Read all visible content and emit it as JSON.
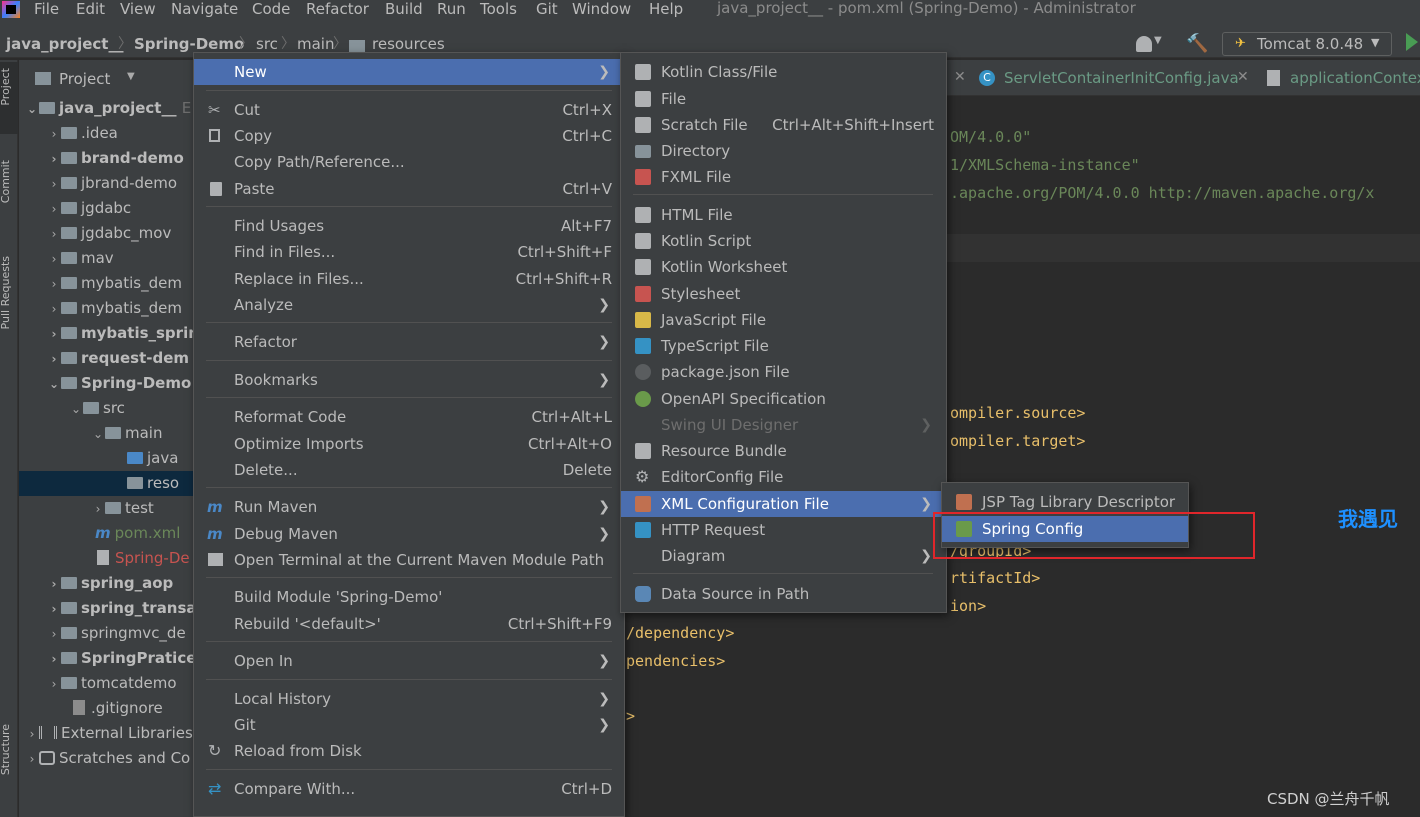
{
  "menubar": {
    "items": [
      "File",
      "Edit",
      "View",
      "Navigate",
      "Code",
      "Refactor",
      "Build",
      "Run",
      "Tools",
      "Git",
      "Window",
      "Help"
    ],
    "window_title": "java_project__ - pom.xml (Spring-Demo) - Administrator"
  },
  "navbar": {
    "crumbs": [
      "java_project__",
      "Spring-Demo",
      "src",
      "main",
      "resources"
    ],
    "run_config": "Tomcat 8.0.48"
  },
  "left_strip": [
    "Project",
    "Commit",
    "Pull Requests",
    "Structure"
  ],
  "project_panel": {
    "title": "Project",
    "tree": [
      {
        "label": "java_project__",
        "suffix": "E",
        "bold": true
      },
      {
        "label": ".idea"
      },
      {
        "label": "brand-demo",
        "bold": true
      },
      {
        "label": "jbrand-demo"
      },
      {
        "label": "jgdabc"
      },
      {
        "label": "jgdabc_mov"
      },
      {
        "label": "mav"
      },
      {
        "label": "mybatis_dem"
      },
      {
        "label": "mybatis_dem"
      },
      {
        "label": "mybatis_sprin",
        "bold": true
      },
      {
        "label": "request-dem",
        "bold": true
      },
      {
        "label": "Spring-Demo",
        "bold": true
      },
      {
        "label": "src"
      },
      {
        "label": "main"
      },
      {
        "label": "java"
      },
      {
        "label": "reso"
      },
      {
        "label": "test"
      },
      {
        "label": "pom.xml"
      },
      {
        "label": "Spring-De"
      },
      {
        "label": "spring_aop",
        "bold": true
      },
      {
        "label": "spring_transa",
        "bold": true
      },
      {
        "label": "springmvc_de"
      },
      {
        "label": "SpringPratice",
        "bold": true
      },
      {
        "label": "tomcatdemo"
      },
      {
        "label": ".gitignore"
      },
      {
        "label": "External Libraries"
      },
      {
        "label": "Scratches and Co"
      }
    ]
  },
  "editor": {
    "tabs": [
      "ServletContainerInitConfig.java",
      "applicationContex"
    ],
    "code_lines": [
      "OM/4.0.0\"",
      "1/XMLSchema-instance\"",
      ".apache.org/POM/4.0.0 http://maven.apache.org/x",
      "ompiler.source>",
      "ompiler.target>",
      "/groupId>",
      "rtifactId>",
      "ion>",
      "/dependency>",
      "pendencies>",
      ">"
    ],
    "overlay_text": "我遇见",
    "watermark": "CSDN @兰舟千帆"
  },
  "context_menu": {
    "items": [
      {
        "label": "New",
        "shortcut": "",
        "submenu": true
      },
      {
        "label": "Cut",
        "shortcut": "Ctrl+X"
      },
      {
        "label": "Copy",
        "shortcut": "Ctrl+C"
      },
      {
        "label": "Copy Path/Reference...",
        "shortcut": ""
      },
      {
        "label": "Paste",
        "shortcut": "Ctrl+V"
      },
      {
        "label": "Find Usages",
        "shortcut": "Alt+F7"
      },
      {
        "label": "Find in Files...",
        "shortcut": "Ctrl+Shift+F"
      },
      {
        "label": "Replace in Files...",
        "shortcut": "Ctrl+Shift+R"
      },
      {
        "label": "Analyze",
        "shortcut": "",
        "submenu": true
      },
      {
        "label": "Refactor",
        "shortcut": "",
        "submenu": true
      },
      {
        "label": "Bookmarks",
        "shortcut": "",
        "submenu": true
      },
      {
        "label": "Reformat Code",
        "shortcut": "Ctrl+Alt+L"
      },
      {
        "label": "Optimize Imports",
        "shortcut": "Ctrl+Alt+O"
      },
      {
        "label": "Delete...",
        "shortcut": "Delete"
      },
      {
        "label": "Run Maven",
        "shortcut": "",
        "submenu": true
      },
      {
        "label": "Debug Maven",
        "shortcut": "",
        "submenu": true
      },
      {
        "label": "Open Terminal at the Current Maven Module Path",
        "shortcut": ""
      },
      {
        "label": "Build Module 'Spring-Demo'",
        "shortcut": ""
      },
      {
        "label": "Rebuild '<default>'",
        "shortcut": "Ctrl+Shift+F9"
      },
      {
        "label": "Open In",
        "shortcut": "",
        "submenu": true
      },
      {
        "label": "Local History",
        "shortcut": "",
        "submenu": true
      },
      {
        "label": "Git",
        "shortcut": "",
        "submenu": true
      },
      {
        "label": "Reload from Disk",
        "shortcut": ""
      },
      {
        "label": "Compare With...",
        "shortcut": "Ctrl+D"
      }
    ]
  },
  "new_submenu": {
    "items": [
      {
        "label": "Kotlin Class/File"
      },
      {
        "label": "File"
      },
      {
        "label": "Scratch File",
        "shortcut": "Ctrl+Alt+Shift+Insert"
      },
      {
        "label": "Directory"
      },
      {
        "label": "FXML File"
      },
      {
        "label": "HTML File"
      },
      {
        "label": "Kotlin Script"
      },
      {
        "label": "Kotlin Worksheet"
      },
      {
        "label": "Stylesheet"
      },
      {
        "label": "JavaScript File"
      },
      {
        "label": "TypeScript File"
      },
      {
        "label": "package.json File"
      },
      {
        "label": "OpenAPI Specification"
      },
      {
        "label": "Swing UI Designer",
        "disabled": true
      },
      {
        "label": "Resource Bundle"
      },
      {
        "label": "EditorConfig File"
      },
      {
        "label": "XML Configuration File",
        "submenu": true
      },
      {
        "label": "HTTP Request"
      },
      {
        "label": "Diagram",
        "submenu": true
      },
      {
        "label": "Data Source in Path"
      }
    ]
  },
  "xml_submenu": {
    "items": [
      {
        "label": "JSP Tag Library Descriptor"
      },
      {
        "label": "Spring Config"
      }
    ]
  },
  "colors": {
    "selection": "#4b6eaf",
    "menu_bg": "#3c3f41",
    "editor_bg": "#2b2b2b",
    "highlight_box": "#e0262b",
    "xml_tag": "#e8bf6a",
    "xml_string": "#6a8759",
    "overlay_text": "#1e90ff"
  }
}
